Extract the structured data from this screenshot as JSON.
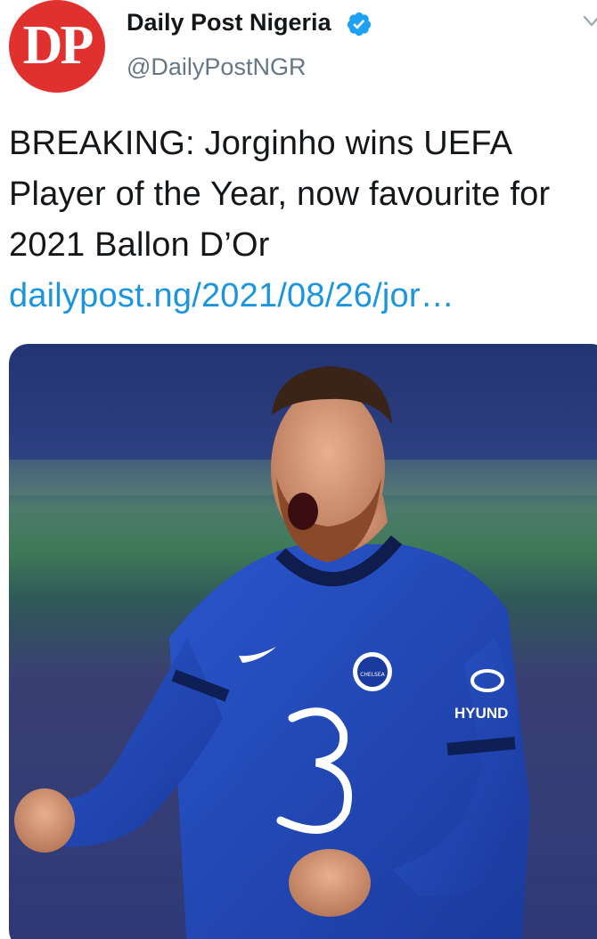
{
  "account": {
    "avatar_text": "DP",
    "display_name": "Daily Post Nigeria",
    "handle": "@DailyPostNGR",
    "verified": true
  },
  "tweet": {
    "text": "BREAKING: Jorginho wins UEFA Player of the Year, now favourite for 2021 Ballon D’Or ",
    "link_text": "dailypost.ng/2021/08/26/jor…"
  },
  "media": {
    "description_icon": "photo",
    "shirt_sponsor": "HYUND",
    "badge_text": "CHELSEA"
  },
  "colors": {
    "avatar_bg": "#e0312f",
    "link": "#1b95e0",
    "verified": "#1da1f2",
    "handle": "#657786",
    "shirt": "#1f47b8"
  },
  "icons": {
    "verified": "verified-badge-icon",
    "more": "chevron-down-icon"
  }
}
